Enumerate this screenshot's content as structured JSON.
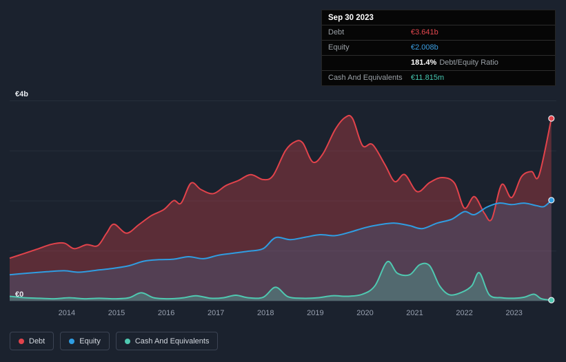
{
  "tooltip": {
    "date": "Sep 30 2023",
    "debt": {
      "label": "Debt",
      "value": "€3.641b",
      "color": "#e5484f"
    },
    "equity": {
      "label": "Equity",
      "value": "€2.008b",
      "color": "#3b9fe3"
    },
    "ratio": {
      "value": "181.4%",
      "label": "Debt/Equity Ratio"
    },
    "cash": {
      "label": "Cash And Equivalents",
      "value": "€11.815m",
      "color": "#46c8b2"
    }
  },
  "legend": {
    "items": [
      {
        "label": "Debt",
        "color": "#e2434b"
      },
      {
        "label": "Equity",
        "color": "#2f9de2"
      },
      {
        "label": "Cash And Equivalents",
        "color": "#4fc9b1"
      }
    ]
  },
  "chart_data": {
    "type": "area",
    "x_range": [
      2012.85,
      2023.85
    ],
    "y_range": [
      0,
      4
    ],
    "x_ticks": [
      2014,
      2015,
      2016,
      2017,
      2018,
      2019,
      2020,
      2021,
      2022,
      2023
    ],
    "y_gridlines": [
      0,
      1,
      2,
      3,
      4
    ],
    "y_axis_labels": [
      {
        "value": 4,
        "label": "€4b"
      },
      {
        "value": 0,
        "label": "€0"
      }
    ],
    "x_unit": "year",
    "y_unit": "EUR billions",
    "legend_position": "bottom-left",
    "grid": true,
    "series": [
      {
        "name": "Debt",
        "color": "#e2434b",
        "end_value": 3.641,
        "points": [
          [
            2012.85,
            0.85
          ],
          [
            2013.1,
            0.93
          ],
          [
            2013.4,
            1.03
          ],
          [
            2013.7,
            1.13
          ],
          [
            2013.95,
            1.15
          ],
          [
            2014.15,
            1.04
          ],
          [
            2014.4,
            1.12
          ],
          [
            2014.62,
            1.1
          ],
          [
            2014.8,
            1.35
          ],
          [
            2014.95,
            1.53
          ],
          [
            2015.2,
            1.35
          ],
          [
            2015.45,
            1.52
          ],
          [
            2015.7,
            1.7
          ],
          [
            2015.95,
            1.82
          ],
          [
            2016.15,
            2.0
          ],
          [
            2016.3,
            1.95
          ],
          [
            2016.5,
            2.35
          ],
          [
            2016.7,
            2.22
          ],
          [
            2016.95,
            2.14
          ],
          [
            2017.2,
            2.3
          ],
          [
            2017.45,
            2.4
          ],
          [
            2017.7,
            2.52
          ],
          [
            2017.95,
            2.42
          ],
          [
            2018.15,
            2.5
          ],
          [
            2018.4,
            3.0
          ],
          [
            2018.6,
            3.18
          ],
          [
            2018.75,
            3.15
          ],
          [
            2018.95,
            2.77
          ],
          [
            2019.15,
            2.93
          ],
          [
            2019.4,
            3.42
          ],
          [
            2019.6,
            3.66
          ],
          [
            2019.75,
            3.64
          ],
          [
            2019.95,
            3.1
          ],
          [
            2020.15,
            3.12
          ],
          [
            2020.4,
            2.72
          ],
          [
            2020.6,
            2.38
          ],
          [
            2020.8,
            2.52
          ],
          [
            2021.05,
            2.18
          ],
          [
            2021.3,
            2.36
          ],
          [
            2021.55,
            2.46
          ],
          [
            2021.8,
            2.35
          ],
          [
            2022.0,
            1.85
          ],
          [
            2022.2,
            2.08
          ],
          [
            2022.4,
            1.75
          ],
          [
            2022.55,
            1.63
          ],
          [
            2022.75,
            2.32
          ],
          [
            2022.95,
            2.06
          ],
          [
            2023.15,
            2.48
          ],
          [
            2023.35,
            2.58
          ],
          [
            2023.5,
            2.5
          ],
          [
            2023.75,
            3.641
          ]
        ]
      },
      {
        "name": "Equity",
        "color": "#2f9de2",
        "end_value": 2.008,
        "points": [
          [
            2012.85,
            0.52
          ],
          [
            2013.2,
            0.55
          ],
          [
            2013.6,
            0.58
          ],
          [
            2013.95,
            0.6
          ],
          [
            2014.25,
            0.57
          ],
          [
            2014.6,
            0.61
          ],
          [
            2014.95,
            0.65
          ],
          [
            2015.25,
            0.7
          ],
          [
            2015.55,
            0.79
          ],
          [
            2015.85,
            0.82
          ],
          [
            2016.15,
            0.83
          ],
          [
            2016.45,
            0.88
          ],
          [
            2016.75,
            0.84
          ],
          [
            2017.05,
            0.91
          ],
          [
            2017.35,
            0.95
          ],
          [
            2017.65,
            0.99
          ],
          [
            2017.95,
            1.04
          ],
          [
            2018.2,
            1.26
          ],
          [
            2018.5,
            1.22
          ],
          [
            2018.8,
            1.27
          ],
          [
            2019.1,
            1.32
          ],
          [
            2019.4,
            1.3
          ],
          [
            2019.7,
            1.37
          ],
          [
            2020.0,
            1.46
          ],
          [
            2020.3,
            1.52
          ],
          [
            2020.6,
            1.55
          ],
          [
            2020.9,
            1.5
          ],
          [
            2021.15,
            1.44
          ],
          [
            2021.45,
            1.55
          ],
          [
            2021.75,
            1.63
          ],
          [
            2022.0,
            1.78
          ],
          [
            2022.2,
            1.72
          ],
          [
            2022.45,
            1.87
          ],
          [
            2022.7,
            1.95
          ],
          [
            2022.95,
            1.92
          ],
          [
            2023.2,
            1.95
          ],
          [
            2023.45,
            1.9
          ],
          [
            2023.6,
            1.88
          ],
          [
            2023.75,
            2.008
          ]
        ]
      },
      {
        "name": "Cash And Equivalents",
        "color": "#4fc9b1",
        "end_value": 0.011815,
        "points": [
          [
            2012.85,
            0.09
          ],
          [
            2013.15,
            0.06
          ],
          [
            2013.45,
            0.05
          ],
          [
            2013.75,
            0.04
          ],
          [
            2014.05,
            0.06
          ],
          [
            2014.35,
            0.04
          ],
          [
            2014.65,
            0.05
          ],
          [
            2014.95,
            0.04
          ],
          [
            2015.25,
            0.06
          ],
          [
            2015.5,
            0.16
          ],
          [
            2015.75,
            0.06
          ],
          [
            2016.05,
            0.04
          ],
          [
            2016.35,
            0.06
          ],
          [
            2016.6,
            0.1
          ],
          [
            2016.9,
            0.05
          ],
          [
            2017.15,
            0.06
          ],
          [
            2017.4,
            0.11
          ],
          [
            2017.65,
            0.06
          ],
          [
            2017.95,
            0.07
          ],
          [
            2018.2,
            0.27
          ],
          [
            2018.45,
            0.08
          ],
          [
            2018.75,
            0.05
          ],
          [
            2019.05,
            0.06
          ],
          [
            2019.35,
            0.1
          ],
          [
            2019.65,
            0.09
          ],
          [
            2019.95,
            0.13
          ],
          [
            2020.2,
            0.3
          ],
          [
            2020.45,
            0.78
          ],
          [
            2020.65,
            0.55
          ],
          [
            2020.9,
            0.52
          ],
          [
            2021.1,
            0.72
          ],
          [
            2021.3,
            0.7
          ],
          [
            2021.5,
            0.3
          ],
          [
            2021.7,
            0.12
          ],
          [
            2021.95,
            0.17
          ],
          [
            2022.15,
            0.3
          ],
          [
            2022.3,
            0.56
          ],
          [
            2022.5,
            0.12
          ],
          [
            2022.75,
            0.06
          ],
          [
            2023.0,
            0.05
          ],
          [
            2023.2,
            0.07
          ],
          [
            2023.4,
            0.13
          ],
          [
            2023.55,
            0.04
          ],
          [
            2023.75,
            0.012
          ]
        ]
      }
    ]
  }
}
